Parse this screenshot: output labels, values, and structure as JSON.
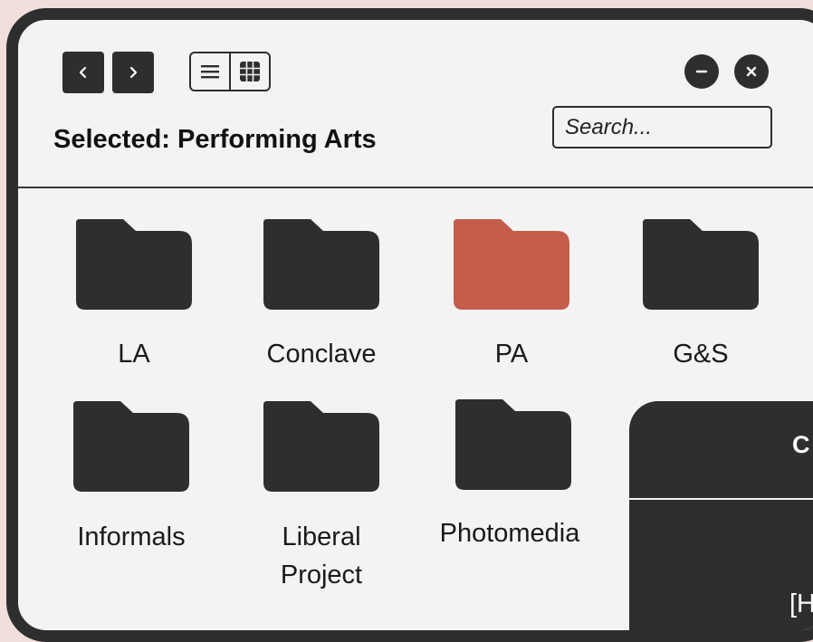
{
  "toolbar": {
    "back_icon": "chevron-left-icon",
    "forward_icon": "chevron-right-icon",
    "list_view_icon": "list-icon",
    "grid_view_icon": "grid-icon",
    "minimize_icon": "minus-icon",
    "close_icon": "close-icon"
  },
  "header": {
    "selected_label": "Selected: Performing Arts",
    "search_placeholder": "Search..."
  },
  "folders": [
    {
      "label": "LA",
      "selected": false
    },
    {
      "label": "Conclave",
      "selected": false
    },
    {
      "label": "PA",
      "selected": true
    },
    {
      "label": "G&S",
      "selected": false
    },
    {
      "label": "Informals",
      "selected": false
    },
    {
      "label": "Liberal Project",
      "selected": false
    },
    {
      "label": "Photomedia",
      "selected": false
    }
  ],
  "panel": {
    "title": "C",
    "text": "[H"
  },
  "colors": {
    "background": "#f2dedb",
    "window": "#f3f3f3",
    "frame": "#2e2e2e",
    "folder": "#2e2e2e",
    "folder_selected": "#c45d4c"
  }
}
